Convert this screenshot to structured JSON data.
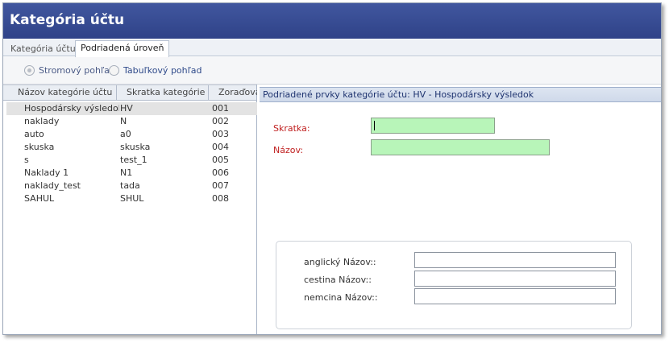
{
  "window": {
    "title": "Kategória účtu"
  },
  "tabs": [
    {
      "label": "Kategória účtu",
      "active": false
    },
    {
      "label": "Podriadená úroveň",
      "active": true
    }
  ],
  "view_options": [
    {
      "label": "Stromový pohľad",
      "selected": true
    },
    {
      "label": "Tabuľkový pohľad",
      "selected": false
    }
  ],
  "grid": {
    "columns": [
      "Názov kategórie účtu",
      "Skratka kategórie",
      "Zoraďovanie"
    ],
    "rows": [
      {
        "name": "Hospodársky výsledok",
        "code": "HV",
        "order": "001",
        "selected": true
      },
      {
        "name": "naklady",
        "code": "N",
        "order": "002"
      },
      {
        "name": "auto",
        "code": "a0",
        "order": "003"
      },
      {
        "name": "skuska",
        "code": "skuska",
        "order": "004"
      },
      {
        "name": "s",
        "code": "test_1",
        "order": "005"
      },
      {
        "name": "Naklady 1",
        "code": "N1",
        "order": "006"
      },
      {
        "name": "naklady_test",
        "code": "tada",
        "order": "007"
      },
      {
        "name": "SAHUL",
        "code": "SHUL",
        "order": "008"
      }
    ]
  },
  "detail": {
    "header": "Podriadené prvky kategórie účtu: HV - Hospodársky výsledok",
    "skratka_label": "Skratka:",
    "skratka_value": "",
    "nazov_label": "Názov:",
    "nazov_value": "",
    "translations": [
      {
        "label": "anglický Názov::",
        "value": ""
      },
      {
        "label": "cestina Názov::",
        "value": ""
      },
      {
        "label": "nemcina Názov::",
        "value": ""
      }
    ]
  },
  "colors": {
    "title_bar": "#3a4f97",
    "required_field": "#b8f5b9",
    "required_label": "#c02020"
  }
}
